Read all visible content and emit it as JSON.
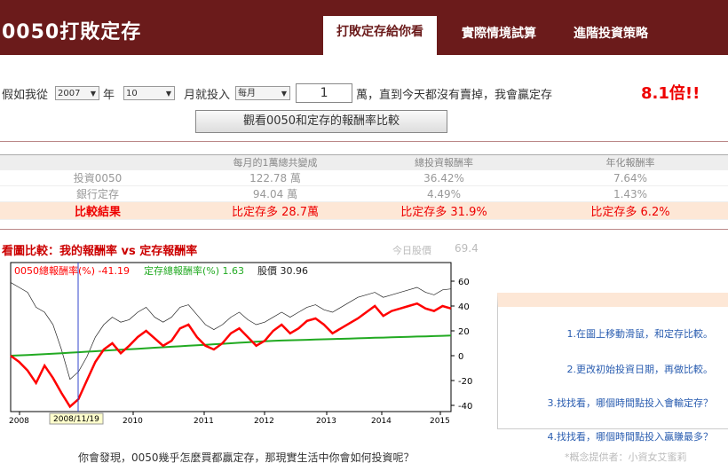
{
  "header": {
    "logo": "0050打敗定存",
    "tabs": [
      {
        "label": "打敗定存給你看"
      },
      {
        "label": "實際情境試算"
      },
      {
        "label": "進階投資策略"
      }
    ]
  },
  "form": {
    "prefix": "假如我從",
    "year": "2007",
    "year_unit": "年",
    "month": "10",
    "text2": "月就投入",
    "freq": "每月",
    "amount": "1",
    "text3": "萬，直到今天都沒有賣掉，我會贏定存",
    "result": "8.1倍!!",
    "compare_button": "觀看0050和定存的報酬率比較"
  },
  "table": {
    "headers": [
      "",
      "每月的1萬總共變成",
      "總投資報酬率",
      "年化報酬率"
    ],
    "rows": [
      {
        "label": "投資0050",
        "total": "122.78 萬",
        "roi": "36.42%",
        "annual": "7.64%"
      },
      {
        "label": "銀行定存",
        "total": "94.04 萬",
        "roi": "4.49%",
        "annual": "1.43%"
      }
    ],
    "compare": {
      "label": "比較結果",
      "total": "比定存多 28.7萬",
      "roi": "比定存多 31.9%",
      "annual": "比定存多 6.2%"
    }
  },
  "chart_section": {
    "title": "看圖比較：我的報酬率 vs 定存報酬率",
    "today_label": "今日股價",
    "today_value": "69.4"
  },
  "chart_data": {
    "type": "line",
    "legend": [
      {
        "name": "0050總報酬率(%) -41.19",
        "color": "#ff0000"
      },
      {
        "name": "定存總報酬率(%) 1.63",
        "color": "#22aa22"
      },
      {
        "name": "股價 30.96",
        "color": "#222222"
      }
    ],
    "x_ticks": [
      "2008",
      "2010",
      "2011",
      "2012",
      "2013",
      "2014",
      "2015"
    ],
    "y_ticks": [
      60,
      40,
      20,
      0,
      -20,
      -40
    ],
    "ylim": [
      -45,
      75
    ],
    "cursor_label": "2008/11/19",
    "x_start": "2007/10",
    "x_end": "2015/04",
    "series": [
      {
        "name": "0050總報酬率(%)",
        "color": "#ff0000",
        "values": [
          0,
          -5,
          -12,
          -22,
          -8,
          -18,
          -30,
          -41,
          -35,
          -20,
          -5,
          5,
          10,
          2,
          8,
          15,
          20,
          14,
          8,
          12,
          22,
          25,
          15,
          8,
          5,
          10,
          18,
          22,
          15,
          8,
          12,
          20,
          25,
          18,
          22,
          28,
          30,
          25,
          18,
          22,
          26,
          30,
          35,
          40,
          32,
          36,
          38,
          40,
          42,
          38,
          36,
          40,
          38
        ]
      },
      {
        "name": "定存總報酬率(%)",
        "color": "#22aa22",
        "values": [
          0,
          0.3,
          0.6,
          0.9,
          1.2,
          1.6,
          2,
          2.4,
          2.8,
          3.2,
          3.6,
          4,
          4.4,
          4.8,
          5.2,
          5.6,
          6,
          6.4,
          6.8,
          7.2,
          7.6,
          8,
          8.4,
          8.8,
          9.2,
          9.6,
          10,
          10.4,
          10.8,
          11.2,
          11.6,
          12,
          12.2,
          12.4,
          12.6,
          12.8,
          13,
          13.2,
          13.4,
          13.6,
          13.8,
          14,
          14.2,
          14.4,
          14.6,
          14.8,
          15,
          15.2,
          15.4,
          15.6,
          15.8,
          16,
          16.2
        ]
      },
      {
        "name": "股價",
        "color": "#222222",
        "values": [
          72,
          70,
          68,
          62,
          60,
          55,
          45,
          33,
          36,
          42,
          50,
          55,
          58,
          56,
          57,
          60,
          62,
          58,
          56,
          58,
          62,
          63,
          59,
          55,
          53,
          55,
          58,
          60,
          57,
          55,
          56,
          58,
          60,
          58,
          60,
          62,
          63,
          61,
          60,
          62,
          64,
          66,
          67,
          68,
          66,
          67,
          68,
          69,
          70,
          68,
          67,
          69,
          69.4
        ]
      }
    ]
  },
  "tips": [
    "1.在圖上移動滑鼠，和定存比較。",
    "2.更改初始投資日期，再做比較。",
    "3.找找看，哪個時間點投入會輸定存？",
    "4.找找看，哪個時間點投入贏賺最多？"
  ],
  "footer": {
    "question": "你會發現，0050幾乎怎麼買都贏定存，那現實生活中你會如何投資呢？",
    "credit": "*概念提供者：小資女艾蜜莉"
  }
}
